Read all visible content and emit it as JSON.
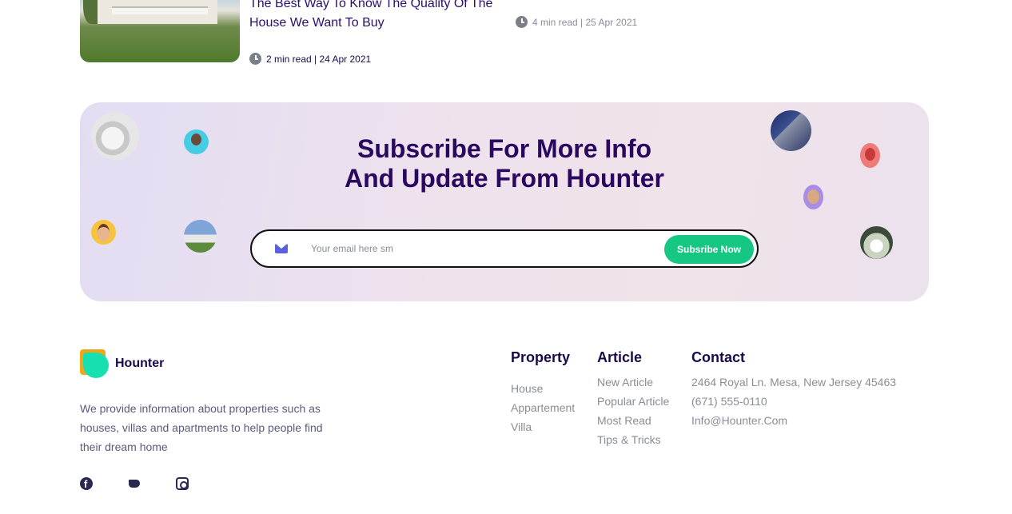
{
  "article": {
    "title": "The Best Way To Know The Quality Of The House We Want To Buy",
    "meta": "2 min read | 24 Apr 2021",
    "meta_2": "4 min read | 25 Apr 2021"
  },
  "subscribe": {
    "title_line1": "Subscribe For More Info",
    "title_line2": "And Update From Hounter",
    "placeholder": "Your email here sm",
    "button": "Subsribe Now"
  },
  "footer": {
    "brand": "Hounter",
    "description": "We provide information about properties such as houses, villas and apartments to help people find their dream home",
    "social": [
      "facebook-icon",
      "twitter-icon",
      "instagram-icon"
    ],
    "columns": {
      "property": {
        "title": "Property",
        "links": [
          "House",
          "Appartement",
          "Villa"
        ]
      },
      "article": {
        "title": "Article",
        "links": [
          "New Article",
          "Popular Article",
          "Most Read",
          "Tips & Tricks"
        ]
      },
      "contact": {
        "title": "Contact",
        "links": [
          "2464 Royal Ln. Mesa, New Jersey 45463",
          "(671) 555-0110",
          "Info@Hounter.Com"
        ]
      }
    }
  },
  "colors": {
    "accent": "#16c784",
    "heading": "#2a0860",
    "logo_orange": "#f2a516",
    "logo_teal": "#16e0b0"
  }
}
